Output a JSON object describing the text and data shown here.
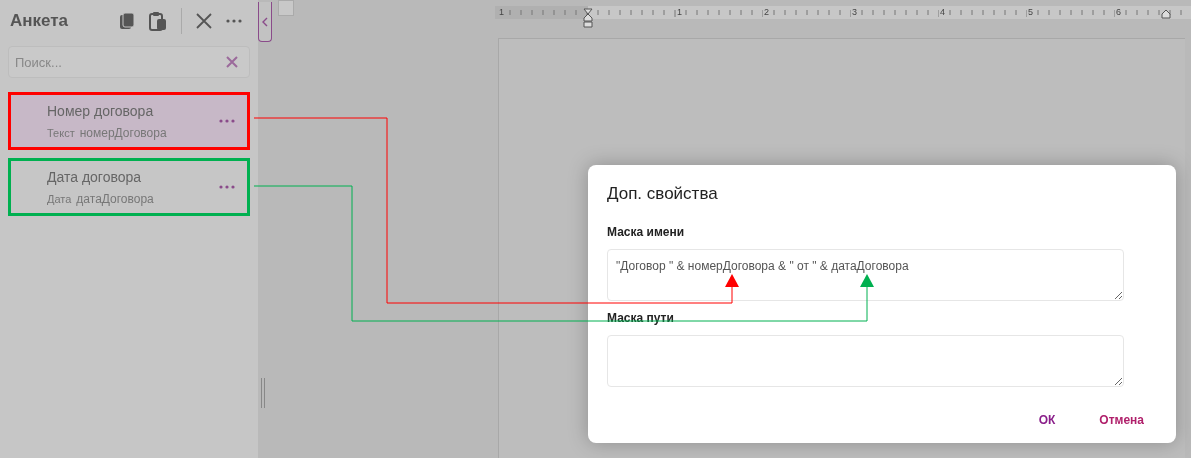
{
  "panel": {
    "title": "Анкета",
    "search": {
      "placeholder": "Поиск..."
    },
    "items": [
      {
        "name": "Номер договора",
        "type": "Текст",
        "variable": "номерДоговора",
        "selected": true,
        "color": "#ff0000"
      },
      {
        "name": "Дата договора",
        "type": "Дата",
        "variable": "датаДоговора",
        "selected": false,
        "color": "#00b050"
      }
    ]
  },
  "ruler": {
    "labels": [
      "1",
      "1",
      "2",
      "3",
      "4",
      "5",
      "6"
    ]
  },
  "dialog": {
    "title": "Доп. свойства",
    "fields": [
      {
        "label": "Маска имени",
        "value": "\"Договор \" & номерДоговора & \" от \" & датаДоговора"
      },
      {
        "label": "Маска пути"
      }
    ],
    "buttons": [
      {
        "label": "ОК",
        "kind": "primary"
      },
      {
        "label": "Отмена",
        "kind": "secondary"
      }
    ]
  }
}
